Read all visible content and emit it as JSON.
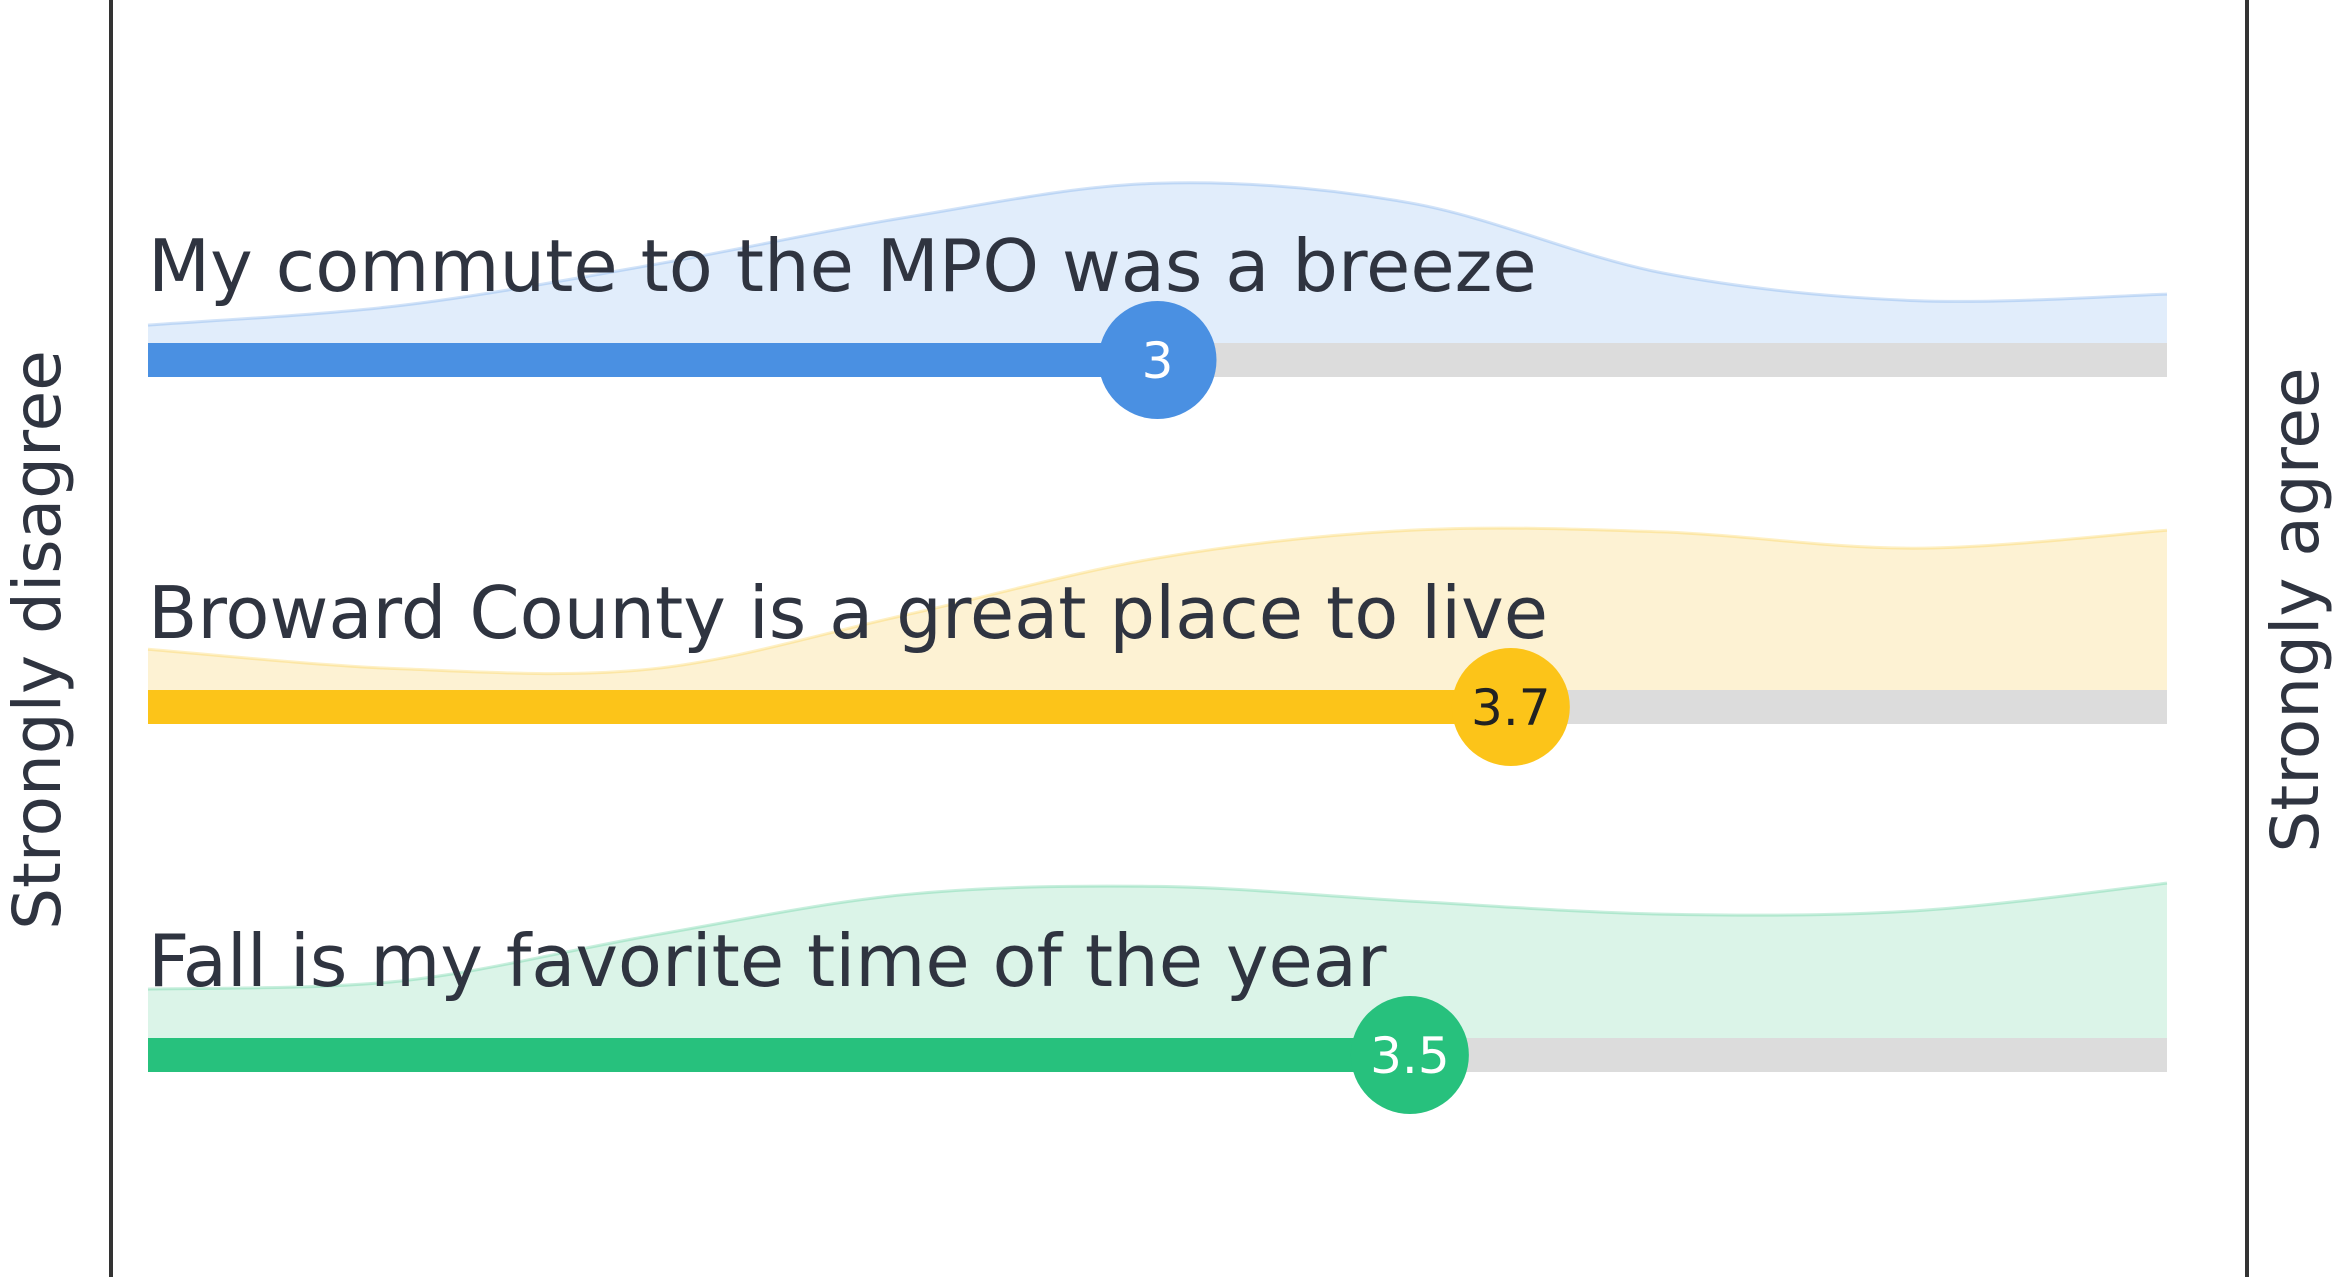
{
  "chart_data": {
    "type": "bar",
    "scale": {
      "min": 1,
      "max": 5
    },
    "left_label": "Strongly disagree",
    "right_label": "Strongly agree",
    "track_color": "#dcdcdc",
    "distribution_points": [
      1,
      1.5,
      2,
      2.5,
      3,
      3.5,
      4,
      4.5,
      5
    ],
    "series": [
      {
        "statement": "My commute to the MPO was a breeze",
        "value": 3,
        "value_label": "3",
        "color": "#4a90e2",
        "fill": "#e1edfb",
        "value_text_color": "#ffffff",
        "distribution": [
          0.11,
          0.23,
          0.48,
          0.77,
          0.98,
          0.86,
          0.43,
          0.26,
          0.3
        ]
      },
      {
        "statement": "Broward County is a great place to live",
        "value": 3.7,
        "value_label": "3.7",
        "color": "#fcc419",
        "fill": "#fdf2d3",
        "value_text_color": "#222222",
        "distribution": [
          0.25,
          0.13,
          0.13,
          0.46,
          0.81,
          0.98,
          0.97,
          0.87,
          0.98
        ]
      },
      {
        "statement": "Fall is my favorite time of the year",
        "value": 3.5,
        "value_label": "3.5",
        "color": "#27c17d",
        "fill": "#dbf4e8",
        "value_text_color": "#ffffff",
        "distribution": [
          0.3,
          0.35,
          0.63,
          0.88,
          0.93,
          0.84,
          0.76,
          0.78,
          0.95
        ]
      }
    ]
  }
}
